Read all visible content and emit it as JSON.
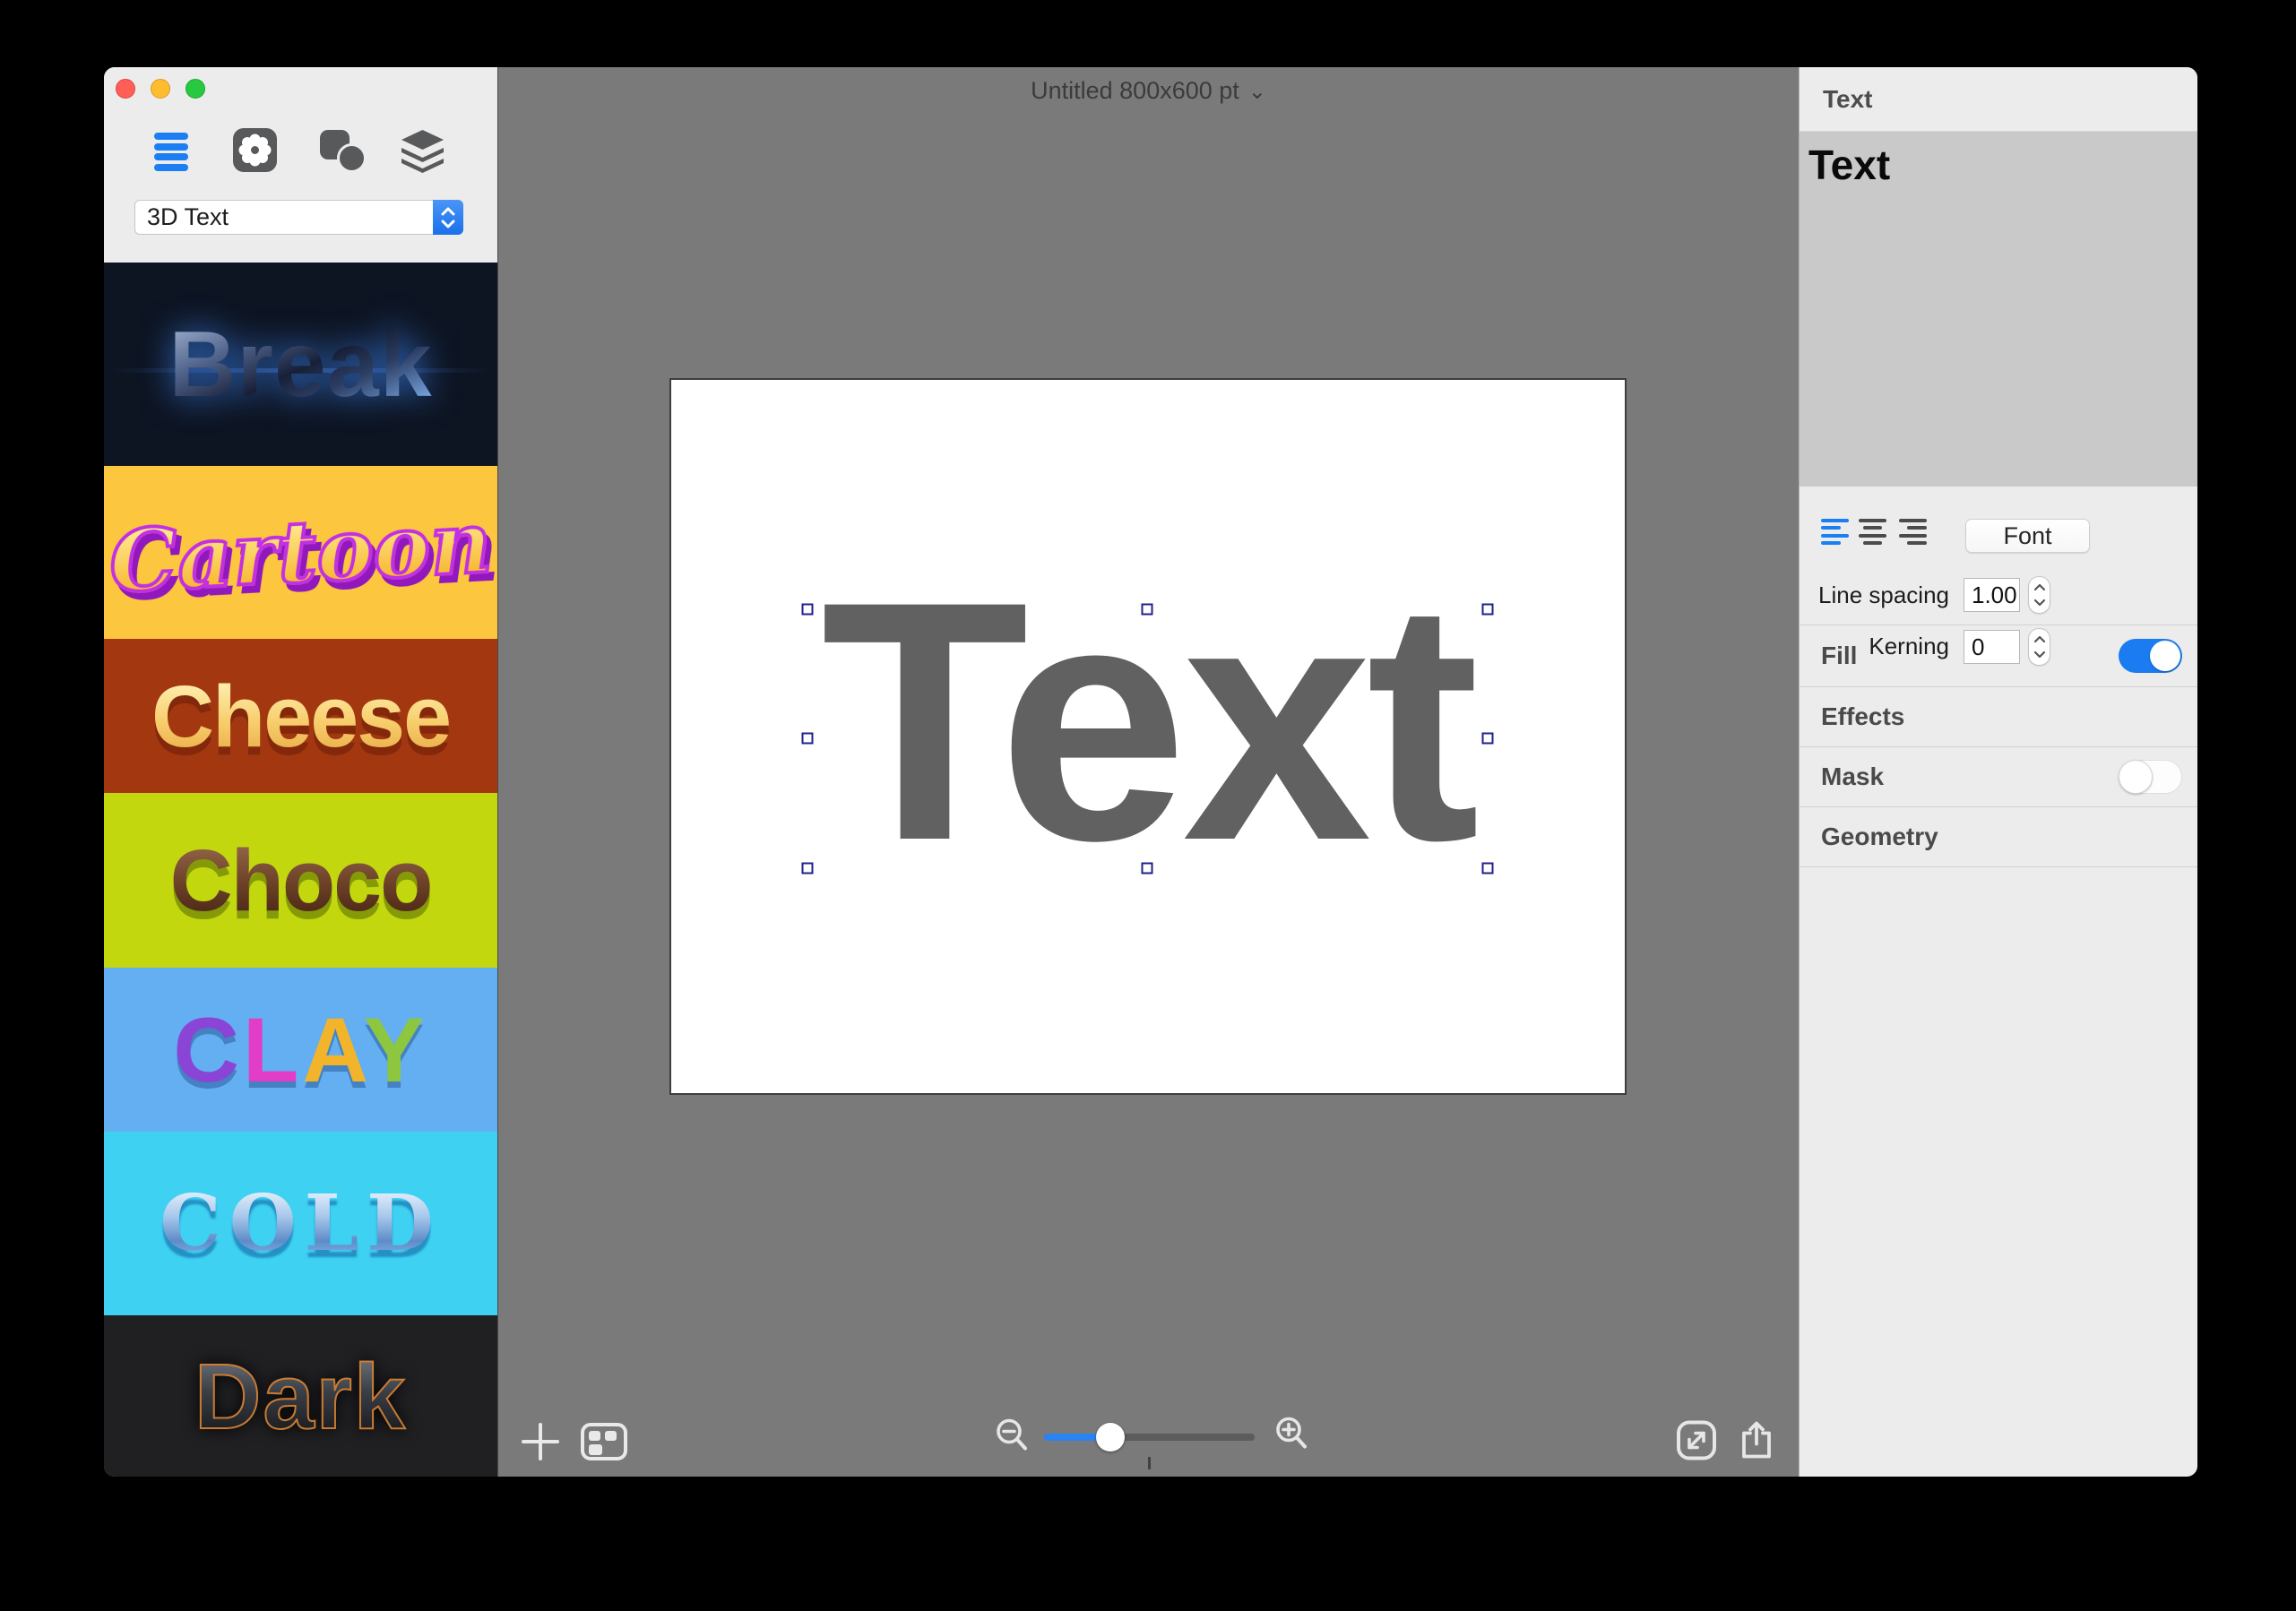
{
  "window": {
    "title": "Untitled 800x600 pt",
    "title_chevron": "⌄",
    "canvas_gray": "#7a7a7a",
    "panel_gray": "#ececec",
    "edit_gray": "#c9c9c9"
  },
  "traffic_lights": {
    "close": "#ff5f57",
    "minimize": "#febc2e",
    "zoom": "#28c840"
  },
  "toolbar": {
    "dropdown_value": "3D Text",
    "icons": [
      "styles-list-icon",
      "settings-flower-icon",
      "shapes-icon",
      "layers-icon"
    ],
    "active_icon_color": "#1b7ef2",
    "icon_color": "#58595a"
  },
  "presets": [
    {
      "label": "Break",
      "bg": "#0d1422"
    },
    {
      "label": "Cartoon",
      "bg": "#fcc63e"
    },
    {
      "label": "Cheese",
      "bg": "#a23710"
    },
    {
      "label": "Choco",
      "bg": "#c3d70f"
    },
    {
      "label": "CLAY",
      "bg": "#64aef2",
      "letters": [
        {
          "ch": "C",
          "color": "#8a45d6"
        },
        {
          "ch": "L",
          "color": "#e23cc8"
        },
        {
          "ch": "A",
          "color": "#f2b42a"
        },
        {
          "ch": "Y",
          "color": "#8dc63f"
        }
      ]
    },
    {
      "label": "COLD",
      "bg": "#3ed1f2"
    },
    {
      "label": "Dark",
      "bg": "#202023"
    }
  ],
  "canvas": {
    "object_text": "Text",
    "text_color": "#616161",
    "selection_handle_border": "#20208e"
  },
  "zoom_slider": {
    "fraction": 0.315,
    "fill_color": "#2a83f2"
  },
  "inspector": {
    "header": "Text",
    "content_text": "Text",
    "font_button": "Font",
    "line_spacing_label": "Line spacing",
    "line_spacing_value": "1.00",
    "kerning_label": "Kerning",
    "kerning_value": "0",
    "accent": "#1a7cf0",
    "rows": [
      {
        "label": "Fill",
        "toggle": "on"
      },
      {
        "label": "Effects",
        "toggle": null
      },
      {
        "label": "Mask",
        "toggle": "off"
      },
      {
        "label": "Geometry",
        "toggle": null
      }
    ]
  }
}
